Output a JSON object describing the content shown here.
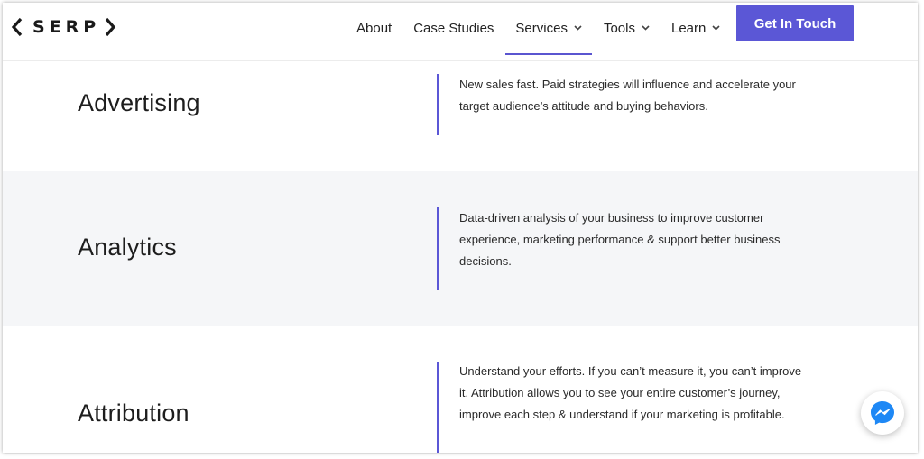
{
  "brand": {
    "logo_text": "SERP",
    "accent_color": "#5b57d6"
  },
  "nav": {
    "items": [
      {
        "label": "About",
        "has_dropdown": false,
        "active": false
      },
      {
        "label": "Case Studies",
        "has_dropdown": false,
        "active": false
      },
      {
        "label": "Services",
        "has_dropdown": true,
        "active": true
      },
      {
        "label": "Tools",
        "has_dropdown": true,
        "active": false
      },
      {
        "label": "Learn",
        "has_dropdown": true,
        "active": false
      }
    ],
    "cta_label": "Get In Touch"
  },
  "sections": [
    {
      "title": "Advertising",
      "description": "New sales fast. Paid strategies will influence and accelerate your target audience’s attitude and buying behaviors."
    },
    {
      "title": "Analytics",
      "description": "Data-driven analysis of your business to improve customer experience, marketing performance & support better business decisions."
    },
    {
      "title": "Attribution",
      "description": "Understand your efforts. If you can’t measure it, you can’t improve it. Attribution allows you to see your entire customer’s journey, improve each step & understand if your marketing is profitable."
    }
  ],
  "icons": {
    "logo_left": "chevron-left-icon",
    "logo_right": "chevron-right-icon",
    "dropdown": "chevron-down-icon",
    "chat": "messenger-icon"
  },
  "colors": {
    "section_alt_bg": "#f5f6f8",
    "messenger_blue": "#1e88f5"
  }
}
